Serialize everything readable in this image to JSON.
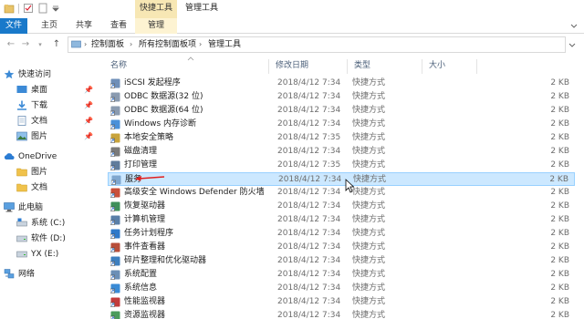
{
  "titlebar": {
    "context_tab": "快捷工具",
    "window_title": "管理工具"
  },
  "ribbon": {
    "tabs": [
      "文件",
      "主页",
      "共享",
      "查看",
      "管理"
    ]
  },
  "address": {
    "crumbs": [
      "控制面板",
      "所有控制面板项",
      "管理工具"
    ]
  },
  "columns": {
    "name": "名称",
    "date": "修改日期",
    "type": "类型",
    "size": "大小"
  },
  "nav": {
    "quick_access": "快速访问",
    "desktop": "桌面",
    "downloads": "下载",
    "documents": "文档",
    "pictures": "图片",
    "onedrive": "OneDrive",
    "od_pictures": "图片",
    "od_documents": "文档",
    "this_pc": "此电脑",
    "drive_c": "系统 (C:)",
    "drive_d": "软件 (D:)",
    "drive_e": "YX (E:)",
    "network": "网络"
  },
  "files": [
    {
      "name": "iSCSI 发起程序",
      "date": "2018/4/12 7:34",
      "type": "快捷方式",
      "size": "2 KB"
    },
    {
      "name": "ODBC 数据源(32 位)",
      "date": "2018/4/12 7:34",
      "type": "快捷方式",
      "size": "2 KB"
    },
    {
      "name": "ODBC 数据源(64 位)",
      "date": "2018/4/12 7:34",
      "type": "快捷方式",
      "size": "2 KB"
    },
    {
      "name": "Windows 内存诊断",
      "date": "2018/4/12 7:34",
      "type": "快捷方式",
      "size": "2 KB"
    },
    {
      "name": "本地安全策略",
      "date": "2018/4/12 7:35",
      "type": "快捷方式",
      "size": "2 KB"
    },
    {
      "name": "磁盘清理",
      "date": "2018/4/12 7:34",
      "type": "快捷方式",
      "size": "2 KB"
    },
    {
      "name": "打印管理",
      "date": "2018/4/12 7:35",
      "type": "快捷方式",
      "size": "2 KB"
    },
    {
      "name": "服务",
      "date": "2018/4/12 7:34",
      "type": "快捷方式",
      "size": "2 KB"
    },
    {
      "name": "高级安全 Windows Defender 防火墙",
      "date": "2018/4/12 7:34",
      "type": "快捷方式",
      "size": "2 KB"
    },
    {
      "name": "恢复驱动器",
      "date": "2018/4/12 7:34",
      "type": "快捷方式",
      "size": "2 KB"
    },
    {
      "name": "计算机管理",
      "date": "2018/4/12 7:34",
      "type": "快捷方式",
      "size": "2 KB"
    },
    {
      "name": "任务计划程序",
      "date": "2018/4/12 7:34",
      "type": "快捷方式",
      "size": "2 KB"
    },
    {
      "name": "事件查看器",
      "date": "2018/4/12 7:34",
      "type": "快捷方式",
      "size": "2 KB"
    },
    {
      "name": "碎片整理和优化驱动器",
      "date": "2018/4/12 7:34",
      "type": "快捷方式",
      "size": "2 KB"
    },
    {
      "name": "系统配置",
      "date": "2018/4/12 7:34",
      "type": "快捷方式",
      "size": "2 KB"
    },
    {
      "name": "系统信息",
      "date": "2018/4/12 7:34",
      "type": "快捷方式",
      "size": "2 KB"
    },
    {
      "name": "性能监视器",
      "date": "2018/4/12 7:34",
      "type": "快捷方式",
      "size": "2 KB"
    },
    {
      "name": "资源监视器",
      "date": "2018/4/12 7:34",
      "type": "快捷方式",
      "size": "2 KB"
    }
  ],
  "selected_file": "服务",
  "colors": {
    "file_tab": "#1979ca",
    "context_tab": "#f7e7b4",
    "selection": "#cce8ff",
    "annotation_arrow": "#e02020"
  }
}
